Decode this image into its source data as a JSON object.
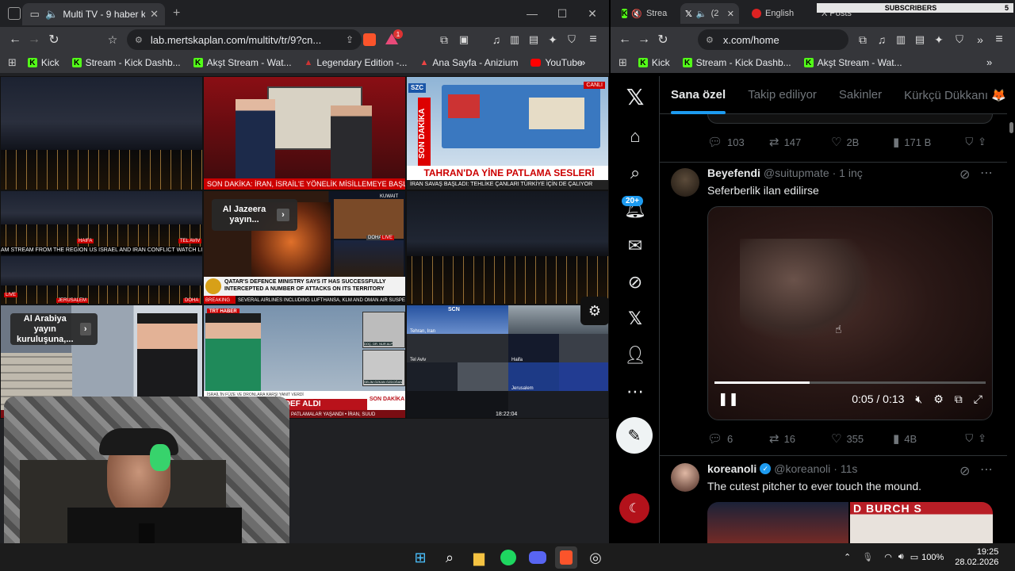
{
  "left_browser": {
    "tab_title": "Multi TV - 9 haber kanalını ay",
    "new_tab_symbol": "+",
    "url": "lab.mertskaplan.com/multitv/tr/9?cn...",
    "bookmarks": [
      "Kick",
      "Stream - Kick Dashb...",
      "Akşt Stream - Wat...",
      "Legendary Edition -...",
      "Ana Sayfa - Anizium",
      "YouTube"
    ],
    "bookmarks_more": "»",
    "notification_count": "1"
  },
  "video_grid": {
    "cnn_chyron": "SON DAKİKA: İRAN, İSRAİL'E YÖNELİK MİSİLLEMEYE BAŞLADI; BİN",
    "szc_badge": "SZC",
    "szc_vertical": "SON DAKİKA",
    "szc_headline": "TAHRAN'DA YİNE PATLAMA SESLERİ",
    "szc_live": "CANLI",
    "szc_ticker": "İRAN SAVAŞ BAŞLADI: TEHLİKE ÇANLARI TÜRKİYE İÇİN DE ÇALIYOR",
    "cam_ticker": "AM STREAM FROM THE REGION US ISRAEL AND IRAN CONFLICT WATCH LIVE",
    "cam_labels": [
      "HAIFA",
      "TEL AVIV",
      "JERUSALEM",
      "DOHA"
    ],
    "cam_live": "LIVE",
    "aj_popup": "Al Jazeera yayın...",
    "aj_location": "KUWAIT",
    "aj_doha": "DOHA",
    "aj_live": "LIVE",
    "aj_headline": "QATAR'S DEFENCE MINISTRY SAYS IT HAS SUCCESSFULLY INTERCEPTED A NUMBER OF ATTACKS ON ITS TERRITORY",
    "aj_breaking": "BREAKING",
    "aj_ticker": "SEVERAL AIRLINES INCLUDING LUFTHANSA, KLM AND OMAN AIR SUSPEND FLIGHTS",
    "alarabiya_popup": "Al Arabiya yayın kuruluşuna,...",
    "trt_brand": "TRT HABER",
    "trt_headline": "İRAN İSRAİL'İ HEDEF ALDI",
    "trt_sub": "PATLAMALAR YAŞANDI • İRAN, SUUD",
    "trt_son": "SON DAKİKA",
    "trt_names": [
      "DOÇ. DR. NUR ALP",
      "SELİM ÖZKAN ÖZDOĞAN"
    ],
    "trt_ticker": "İSRAİL'İN FÜZE VE DRONLARA KARŞI YANIT VERDİ",
    "multicam_time": "18:22:04",
    "multicam_brand": "SCN",
    "multicam_labels": [
      "Tel Aviv",
      "Haifa",
      "Tehran, Iran",
      "Jerusalem"
    ]
  },
  "right_browser": {
    "tabs": [
      "Strea",
      "(2",
      "English",
      "X Posts"
    ],
    "url": "x.com/home",
    "bookmarks": [
      "Kick",
      "Stream - Kick Dashb...",
      "Akşt Stream - Wat..."
    ],
    "bookmarks_more": "»"
  },
  "overlay": {
    "subscribers_label": "SUBSCRIBERS",
    "subscribers_count": "5"
  },
  "x": {
    "feed_tabs": [
      "Sana özel",
      "Takip ediliyor",
      "Sakinler",
      "Kürkçü Dükkanı 🦊"
    ],
    "notification_badge": "20+",
    "prev_stats": {
      "replies": "103",
      "reposts": "147",
      "likes": "2B",
      "views": "171 B"
    },
    "tweet1": {
      "name": "Beyefendi",
      "handle": "@suitupmate",
      "time": "· 1 inç",
      "text": "Seferberlik ilan edilirse",
      "video_time": "0:05 / 0:13",
      "stats": {
        "replies": "6",
        "reposts": "16",
        "likes": "355",
        "views": "4B"
      }
    },
    "tweet2": {
      "name": "koreanoli",
      "handle": "@koreanoli",
      "time": "· 11s",
      "text": "The cutest pitcher to ever touch the mound.",
      "thumb_text": "D BURCH S"
    }
  },
  "taskbar": {
    "battery": "100%",
    "time": "19:25",
    "date": "28.02.2026"
  }
}
